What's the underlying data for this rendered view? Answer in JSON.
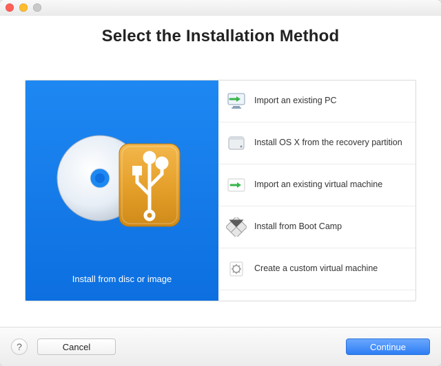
{
  "heading": "Select the Installation Method",
  "preview": {
    "caption": "Install from disc or image"
  },
  "methods": [
    {
      "label": "Import an existing PC",
      "selected": true
    },
    {
      "label": "Install OS X from the recovery partition",
      "selected": false
    },
    {
      "label": "Import an existing virtual machine",
      "selected": false
    },
    {
      "label": "Install from Boot Camp",
      "selected": false
    },
    {
      "label": "Create a custom virtual machine",
      "selected": false
    }
  ],
  "footer": {
    "help": "?",
    "cancel": "Cancel",
    "continue": "Continue"
  }
}
